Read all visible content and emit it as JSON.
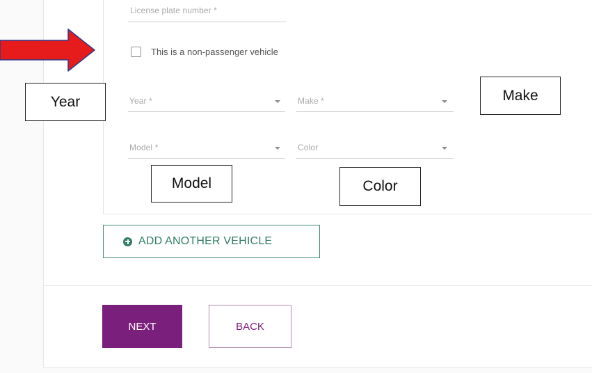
{
  "form": {
    "license_plate_label": "License plate number *",
    "non_passenger_label": "This is a non-passenger vehicle",
    "non_passenger_checked": false,
    "year_label": "Year *",
    "make_label": "Make *",
    "model_label": "Model *",
    "color_label": "Color"
  },
  "actions": {
    "add_vehicle_label": "ADD ANOTHER VEHICLE",
    "next_label": "NEXT",
    "back_label": "BACK"
  },
  "annotations": {
    "year": "Year",
    "make": "Make",
    "model": "Model",
    "color": "Color"
  },
  "colors": {
    "primary": "#7b1f7d",
    "secondary_green": "#2f7d62",
    "arrow_red": "#e61b1b",
    "arrow_outline": "#2b3a8c"
  },
  "icons": {
    "add": "plus-circle-icon",
    "dropdown": "caret-down-icon",
    "pointer": "red-arrow-icon"
  }
}
